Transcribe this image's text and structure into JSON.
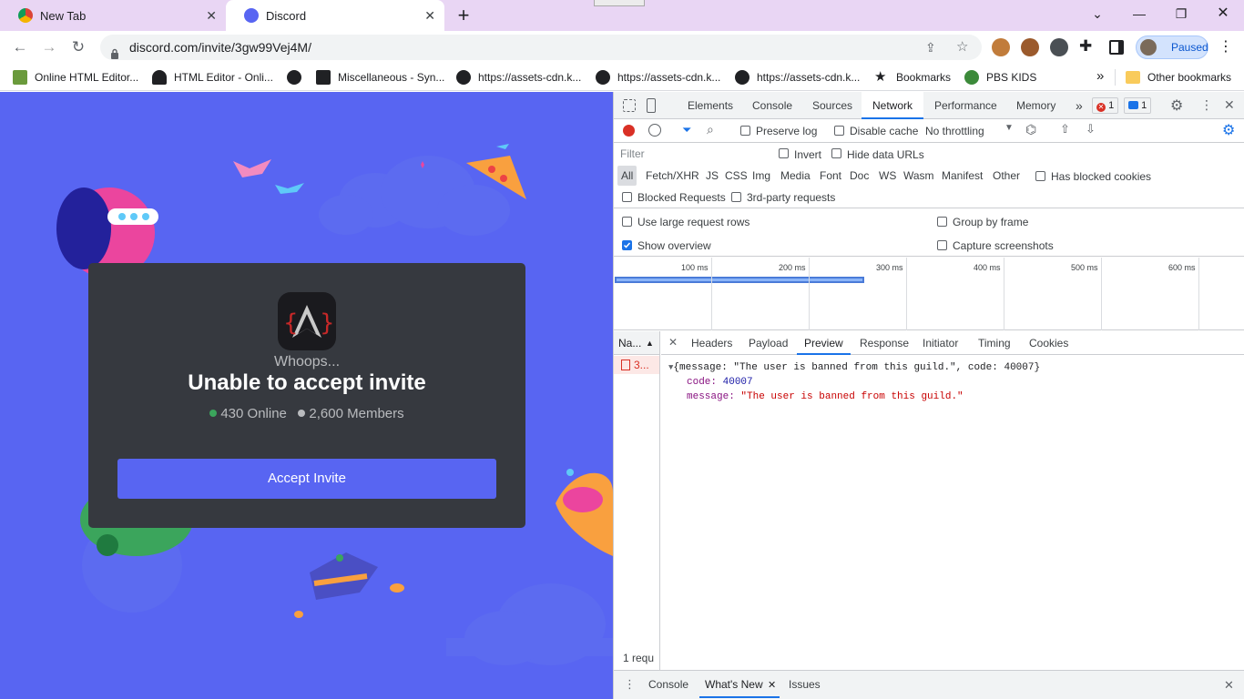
{
  "browser": {
    "tabs": [
      {
        "title": "New Tab"
      },
      {
        "title": "Discord"
      }
    ],
    "url": "discord.com/invite/3gw99Vej4M/",
    "profile_label": "Paused",
    "bookmarks": [
      {
        "label": "Online HTML Editor..."
      },
      {
        "label": "HTML Editor - Onli..."
      },
      {
        "label": ""
      },
      {
        "label": "Miscellaneous - Syn..."
      },
      {
        "label": "https://assets-cdn.k..."
      },
      {
        "label": "https://assets-cdn.k..."
      },
      {
        "label": "https://assets-cdn.k..."
      },
      {
        "label": "Bookmarks"
      },
      {
        "label": "PBS KIDS"
      }
    ],
    "other_bookmarks": "Other bookmarks",
    "overflow": "»"
  },
  "discord": {
    "whoops": "Whoops...",
    "title": "Unable to accept invite",
    "online": "430 Online",
    "members": "2,600 Members",
    "accept_button": "Accept Invite",
    "colors": {
      "blurple": "#5865f2",
      "card": "#36393f",
      "online_dot": "#3ba55c",
      "members_dot": "#b9bbbe"
    }
  },
  "devtools": {
    "panels": [
      "Elements",
      "Console",
      "Sources",
      "Network",
      "Performance",
      "Memory"
    ],
    "active_panel": "Network",
    "more": "»",
    "error_count": "1",
    "message_count": "1",
    "toolbar": {
      "preserve_log": "Preserve log",
      "disable_cache": "Disable cache",
      "throttling": "No throttling"
    },
    "filter_placeholder": "Filter",
    "invert": "Invert",
    "hide_data_urls": "Hide data URLs",
    "types": [
      "All",
      "Fetch/XHR",
      "JS",
      "CSS",
      "Img",
      "Media",
      "Font",
      "Doc",
      "WS",
      "Wasm",
      "Manifest",
      "Other"
    ],
    "has_blocked_cookies": "Has blocked cookies",
    "blocked_requests": "Blocked Requests",
    "third_party": "3rd-party requests",
    "use_large_rows": "Use large request rows",
    "group_by_frame": "Group by frame",
    "show_overview": "Show overview",
    "show_overview_checked": true,
    "capture_screenshots": "Capture screenshots",
    "timeline_ticks": [
      "100 ms",
      "200 ms",
      "300 ms",
      "400 ms",
      "500 ms",
      "600 ms"
    ],
    "request_col": "Na...",
    "request_name": "3...",
    "detail_tabs": [
      "Headers",
      "Payload",
      "Preview",
      "Response",
      "Initiator",
      "Timing",
      "Cookies"
    ],
    "active_detail_tab": "Preview",
    "preview": {
      "summary": "{message: \"The user is banned from this guild.\", code: 40007}",
      "code_key": "code:",
      "code_val": "40007",
      "message_key": "message:",
      "message_val": "\"The user is banned from this guild.\""
    },
    "status_bar": "1 requ",
    "drawer_tabs": [
      "Console",
      "What's New",
      "Issues"
    ],
    "active_drawer_tab": "What's New"
  }
}
